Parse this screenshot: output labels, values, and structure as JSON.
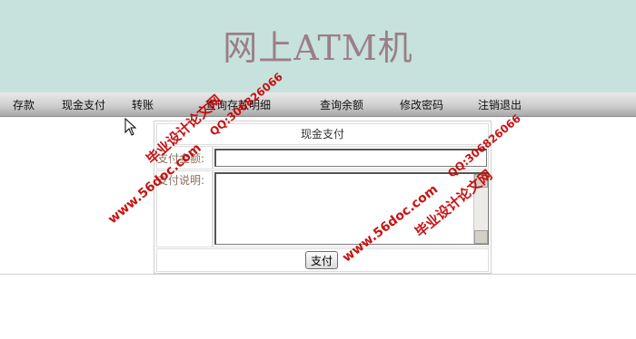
{
  "banner": {
    "title": "网上ATM机"
  },
  "nav": {
    "items": [
      {
        "label": "存款"
      },
      {
        "label": "现金支付"
      },
      {
        "label": "转账"
      },
      {
        "label": "查询存款明细"
      },
      {
        "label": "查询余额"
      },
      {
        "label": "修改密码"
      },
      {
        "label": "注销退出"
      }
    ]
  },
  "form": {
    "title": "现金支付",
    "amount_label": "支付金额:",
    "amount_value": "",
    "description_label": "支付说明:",
    "description_value": "",
    "submit_label": "支付"
  },
  "watermarks": [
    {
      "text": "毕业设计论文网"
    },
    {
      "text": "www.56doc.com"
    },
    {
      "text": "QQ:306826066"
    },
    {
      "text": "毕业设计论文网"
    },
    {
      "text": "www.56doc.com"
    },
    {
      "text": "QQ:306826066"
    }
  ],
  "colors": {
    "banner_bg": "#c7e1dc",
    "banner_title": "#9a7f86",
    "watermark": "#c40000",
    "label": "#8a7060"
  }
}
